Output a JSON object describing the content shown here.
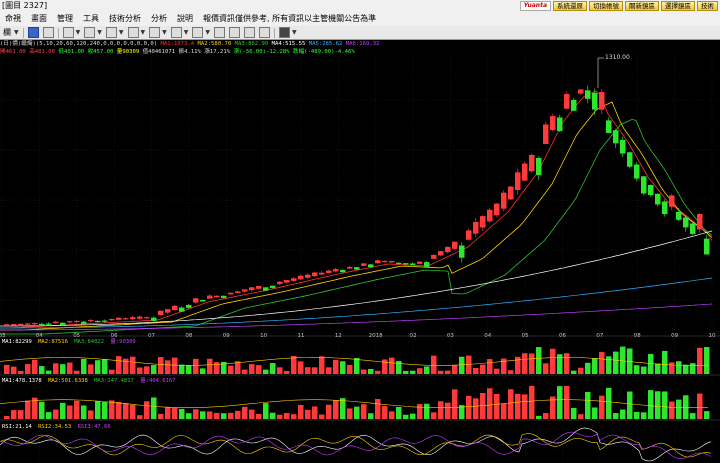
{
  "window": {
    "title": "[圖目 2327]"
  },
  "top_buttons": [
    {
      "label": "系統還原"
    },
    {
      "label": "切換帳號"
    },
    {
      "label": "關新鏡區"
    },
    {
      "label": "選擇鏡區"
    },
    {
      "label": "技術"
    }
  ],
  "brand": {
    "logo_text": "Yuanta"
  },
  "menu": [
    {
      "label": "命視"
    },
    {
      "label": "畫面"
    },
    {
      "label": "管理"
    },
    {
      "label": "工具"
    },
    {
      "label": "技術分析"
    },
    {
      "label": "分析"
    },
    {
      "label": "說明"
    },
    {
      "label": "報價資訊僅供參考, 所有資訊以主管機關公告為準"
    }
  ],
  "toolbar": {
    "period_label": "欄",
    "icons": [
      "save-icon",
      "pointer-icon",
      "trend-line-icon",
      "horizontal-line-icon",
      "vertical-lines-icon",
      "fibonacci-icon",
      "arrow-icon",
      "rectangle-icon",
      "ellipse-icon",
      "text-icon",
      "erase-icon",
      "copy-icon",
      "color-icon",
      "disk-icon"
    ]
  },
  "indicator_lines": {
    "price_header": "(日)價(蠟燭)(5,10,20,60,120,240,0,0,0,0,0,0,0,0)",
    "ma_labels": [
      {
        "text": "MA1:1073.4",
        "color": "#ff3030"
      },
      {
        "text": "MA2:580.70",
        "color": "#ffd000"
      },
      {
        "text": "MA3:802.90",
        "color": "#30c030"
      },
      {
        "text": "MA4:515.55",
        "color": "#ffffff"
      },
      {
        "text": "MA5:285.62",
        "color": "#30b0ff"
      },
      {
        "text": "MA6:169.32",
        "color": "#c040ff"
      }
    ],
    "second_line": [
      {
        "text": "開461.00",
        "color": "#ff4040"
      },
      {
        "text": "高481.00",
        "color": "#ff4040"
      },
      {
        "text": "低401.00",
        "color": "#30ff30"
      },
      {
        "text": "收457.00",
        "color": "#30ff30"
      },
      {
        "text": "量90309",
        "color": "#ffff00"
      },
      {
        "text": "值40461071",
        "color": "#ffffff"
      },
      {
        "text": "振4.11%",
        "color": "#ffffff"
      },
      {
        "text": "漲17.21%",
        "color": "#ffffff"
      },
      {
        "text": "漲(-56.00)-12.28%",
        "color": "#30ff30"
      },
      {
        "text": "跌幅(-489.00)-4.46%",
        "color": "#30ff30"
      }
    ]
  },
  "annotations": {
    "high_label": "1310.00"
  },
  "time_axis": [
    "03",
    "04",
    "05",
    "06",
    "07",
    "08",
    "09",
    "10",
    "11",
    "12",
    "2018",
    "02",
    "03",
    "04",
    "05",
    "06",
    "07",
    "08",
    "09",
    "10"
  ],
  "panels": {
    "volume1": {
      "labels": [
        {
          "text": "MA1:82299",
          "color": "#ffffff"
        },
        {
          "text": "MA2:87516",
          "color": "#ffd000"
        },
        {
          "text": "MA3:84022",
          "color": "#30c030"
        },
        {
          "text": "量:90309",
          "color": "#c040ff"
        }
      ]
    },
    "volume2": {
      "labels": [
        {
          "text": "MA1:478.1378",
          "color": "#ffffff"
        },
        {
          "text": "MA2:501.6338",
          "color": "#ffd000"
        },
        {
          "text": "MA3:247.4817",
          "color": "#30c030"
        },
        {
          "text": "量:404.6167",
          "color": "#c040ff"
        }
      ]
    },
    "kd": {
      "labels": [
        {
          "text": "RSI:21.14",
          "color": "#ffffff"
        },
        {
          "text": "RSI2:34.53",
          "color": "#ffd000"
        },
        {
          "text": "RSI3:47.66",
          "color": "#c040ff"
        }
      ]
    }
  },
  "colors": {
    "up": "#ff3a3a",
    "down": "#2ee62e",
    "background": "#000000"
  }
}
